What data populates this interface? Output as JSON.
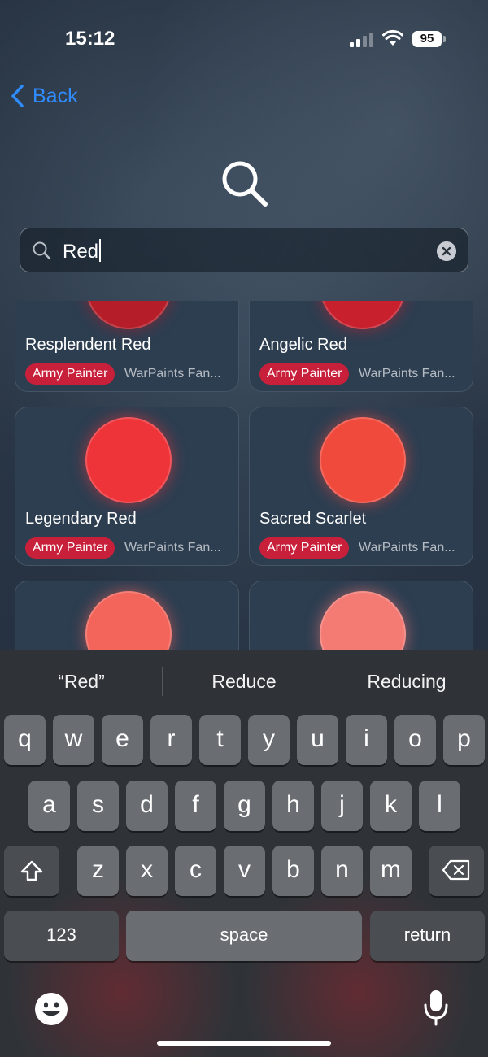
{
  "status_bar": {
    "time": "15:12",
    "battery": "95"
  },
  "nav": {
    "back_label": "Back"
  },
  "search": {
    "value": "Red"
  },
  "results": [
    {
      "name": "Resplendent Red",
      "brand": "Army Painter",
      "source": "WarPaints Fan...",
      "color": "#b51d28"
    },
    {
      "name": "Angelic Red",
      "brand": "Army Painter",
      "source": "WarPaints Fan...",
      "color": "#c9202e"
    },
    {
      "name": "Legendary Red",
      "brand": "Army Painter",
      "source": "WarPaints Fan...",
      "color": "#ee3339"
    },
    {
      "name": "Sacred Scarlet",
      "brand": "Army Painter",
      "source": "WarPaints Fan...",
      "color": "#f04a3d"
    },
    {
      "name": "",
      "brand": "",
      "source": "",
      "color": "#f3645a"
    },
    {
      "name": "",
      "brand": "",
      "source": "",
      "color": "#f47a74"
    }
  ],
  "keyboard": {
    "suggestions": [
      "“Red”",
      "Reduce",
      "Reducing"
    ],
    "row1": [
      "q",
      "w",
      "e",
      "r",
      "t",
      "y",
      "u",
      "i",
      "o",
      "p"
    ],
    "row2": [
      "a",
      "s",
      "d",
      "f",
      "g",
      "h",
      "j",
      "k",
      "l"
    ],
    "row3": [
      "z",
      "x",
      "c",
      "v",
      "b",
      "n",
      "m"
    ],
    "numbers_label": "123",
    "space_label": "space",
    "return_label": "return"
  }
}
